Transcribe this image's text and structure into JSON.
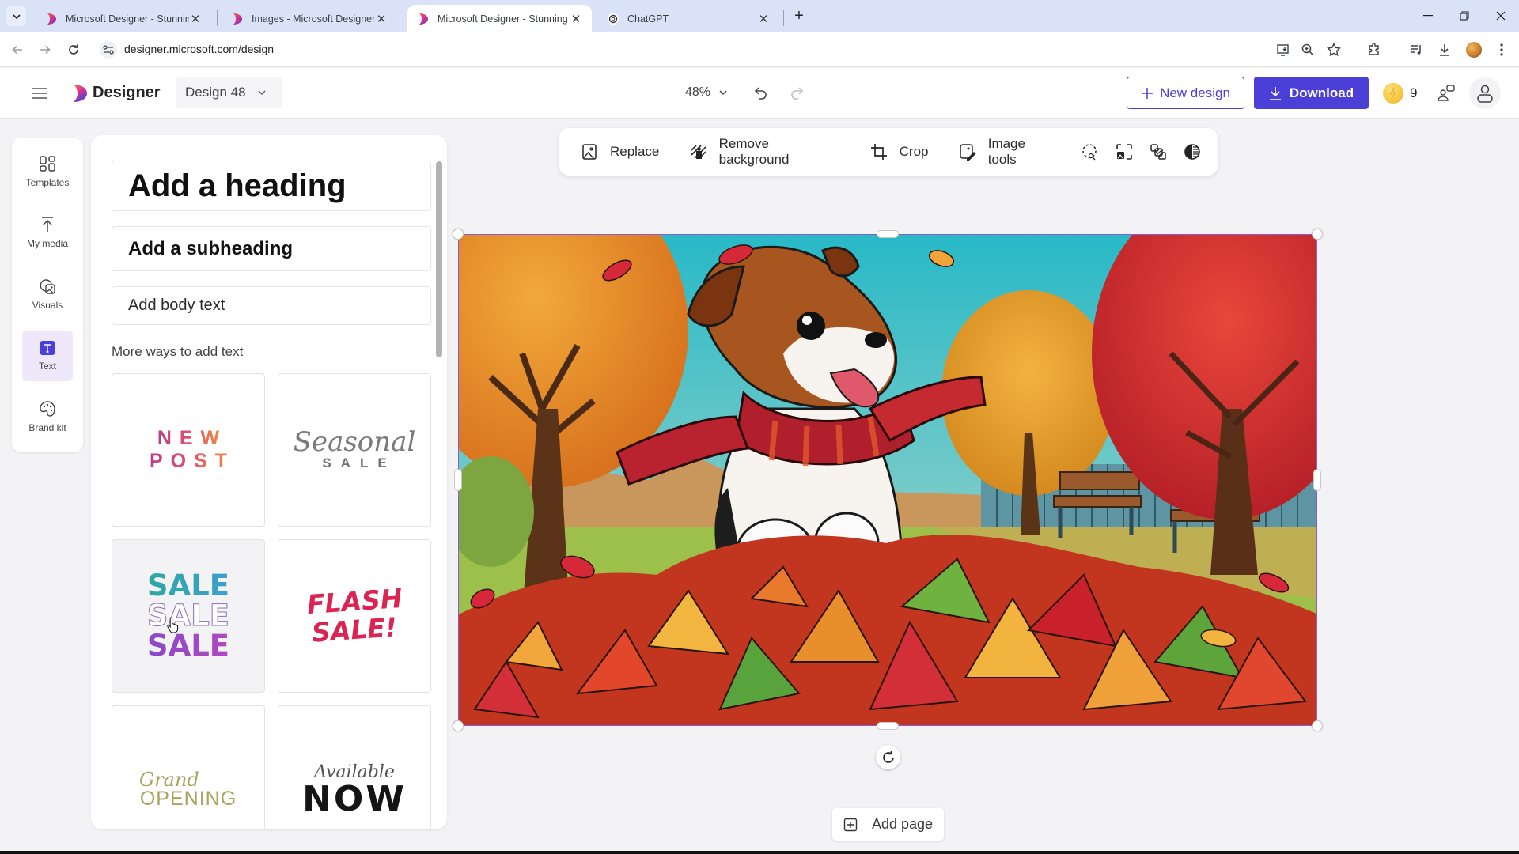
{
  "browser": {
    "tabs": [
      {
        "title": "Microsoft Designer - Stunning designs",
        "favicon": "designer-logo",
        "active": false
      },
      {
        "title": "Images - Microsoft Designer",
        "favicon": "designer-logo",
        "active": false
      },
      {
        "title": "Microsoft Designer - Stunning designs",
        "favicon": "designer-logo",
        "active": true
      },
      {
        "title": "ChatGPT",
        "favicon": "chatgpt-logo",
        "active": false
      }
    ],
    "new_tab_label": "+",
    "url": "designer.microsoft.com/design",
    "toolbar_icons": [
      "install-app-icon",
      "zoom-icon",
      "bookmark-star-icon",
      "extensions-icon",
      "media-controls-icon",
      "downloads-icon",
      "profile-avatar",
      "menu-kebab-icon"
    ],
    "window_controls": [
      "minimize",
      "restore",
      "close"
    ]
  },
  "app": {
    "brand": "Designer",
    "design_name": "Design 48",
    "zoom": "48%",
    "new_design_label": "New design",
    "download_label": "Download",
    "credits": "9",
    "accent_color": "#4b3fd8"
  },
  "rail": {
    "items": [
      {
        "label": "Templates",
        "icon": "templates-grid-icon",
        "active": false
      },
      {
        "label": "My media",
        "icon": "upload-icon",
        "active": false
      },
      {
        "label": "Visuals",
        "icon": "visuals-icon",
        "active": false
      },
      {
        "label": "Text",
        "icon": "text-icon",
        "active": true
      },
      {
        "label": "Brand kit",
        "icon": "palette-icon",
        "active": false
      }
    ]
  },
  "panel": {
    "heading": "Add a heading",
    "subheading": "Add a subheading",
    "body": "Add body text",
    "more_ways": "More ways to add text",
    "templates": [
      {
        "name": "new-post",
        "lines": [
          "NEW",
          "POST"
        ]
      },
      {
        "name": "seasonal-sale",
        "lines": [
          "Seasonal",
          "SALE"
        ]
      },
      {
        "name": "sale-sale-sale",
        "lines": [
          "SALE",
          "SALE",
          "SALE"
        ]
      },
      {
        "name": "flash-sale",
        "lines": [
          "FLASH",
          "SALE!"
        ]
      },
      {
        "name": "grand-opening",
        "lines": [
          "Grand",
          "OPENING"
        ]
      },
      {
        "name": "available-now",
        "lines": [
          "Available",
          "NOW"
        ]
      }
    ]
  },
  "toolbar": {
    "replace": "Replace",
    "remove_background": "Remove background",
    "crop": "Crop",
    "image_tools": "Image tools",
    "icon_buttons": [
      "select-subject-icon",
      "frame-icon",
      "blur-icon",
      "filter-contrast-icon"
    ]
  },
  "canvas": {
    "image_description": "Comic-style puppy in red scarf jumping in autumn leaves in a park"
  },
  "add_page_label": "Add page"
}
